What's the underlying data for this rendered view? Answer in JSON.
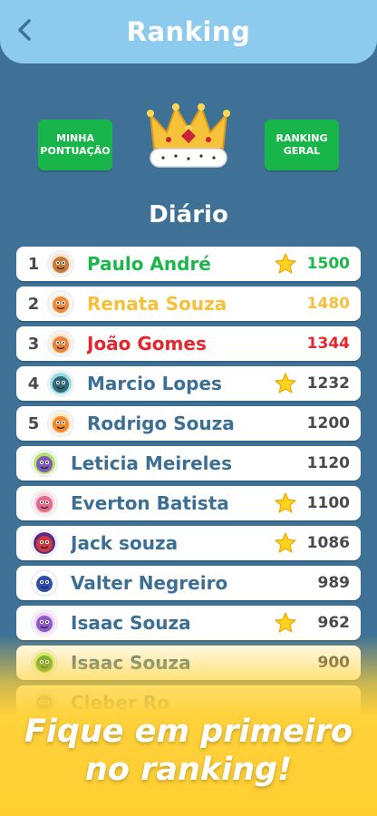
{
  "header": {
    "title": "Ranking"
  },
  "buttons": {
    "my_score": "MINHA PONTUAÇÃO",
    "general_ranking": "RANKING GERAL"
  },
  "section_title": "Diário",
  "colors": {
    "first": "#1ab74b",
    "second": "#f6c03a",
    "third": "#e4262d",
    "default_name": "#3d6f94"
  },
  "ranking": [
    {
      "rank": "1",
      "name": "Paulo André",
      "score": "1500",
      "star": true,
      "avatar": "bear-icon"
    },
    {
      "rank": "2",
      "name": "Renata Souza",
      "score": "1480",
      "star": false,
      "avatar": "fox-icon"
    },
    {
      "rank": "3",
      "name": "João Gomes",
      "score": "1344",
      "star": false,
      "avatar": "lion-icon"
    },
    {
      "rank": "4",
      "name": "Marcio Lopes",
      "score": "1232",
      "star": true,
      "avatar": "monster-icon"
    },
    {
      "rank": "5",
      "name": "Rodrigo Souza",
      "score": "1200",
      "star": false,
      "avatar": "tiger-icon"
    },
    {
      "rank": "",
      "name": "Leticia Meireles",
      "score": "1120",
      "star": false,
      "avatar": "cyclops-icon"
    },
    {
      "rank": "",
      "name": "Everton Batista",
      "score": "1100",
      "star": true,
      "avatar": "pink-monster-icon"
    },
    {
      "rank": "",
      "name": "Jack souza",
      "score": "1086",
      "star": true,
      "avatar": "red-monster-icon"
    },
    {
      "rank": "",
      "name": "Valter Negreiro",
      "score": "989",
      "star": false,
      "avatar": "blue-monster-icon"
    },
    {
      "rank": "",
      "name": "Isaac Souza",
      "score": "962",
      "star": true,
      "avatar": "purple-monster-icon"
    },
    {
      "rank": "",
      "name": "Isaac Souza",
      "score": "900",
      "star": false,
      "avatar": "green-monster-icon"
    },
    {
      "rank": "",
      "name": "Cleber Ro",
      "score": "",
      "star": false,
      "avatar": "gray-monster-icon"
    }
  ],
  "slogan": {
    "line1": "Fique em primeiro",
    "line2": "no ranking!"
  }
}
